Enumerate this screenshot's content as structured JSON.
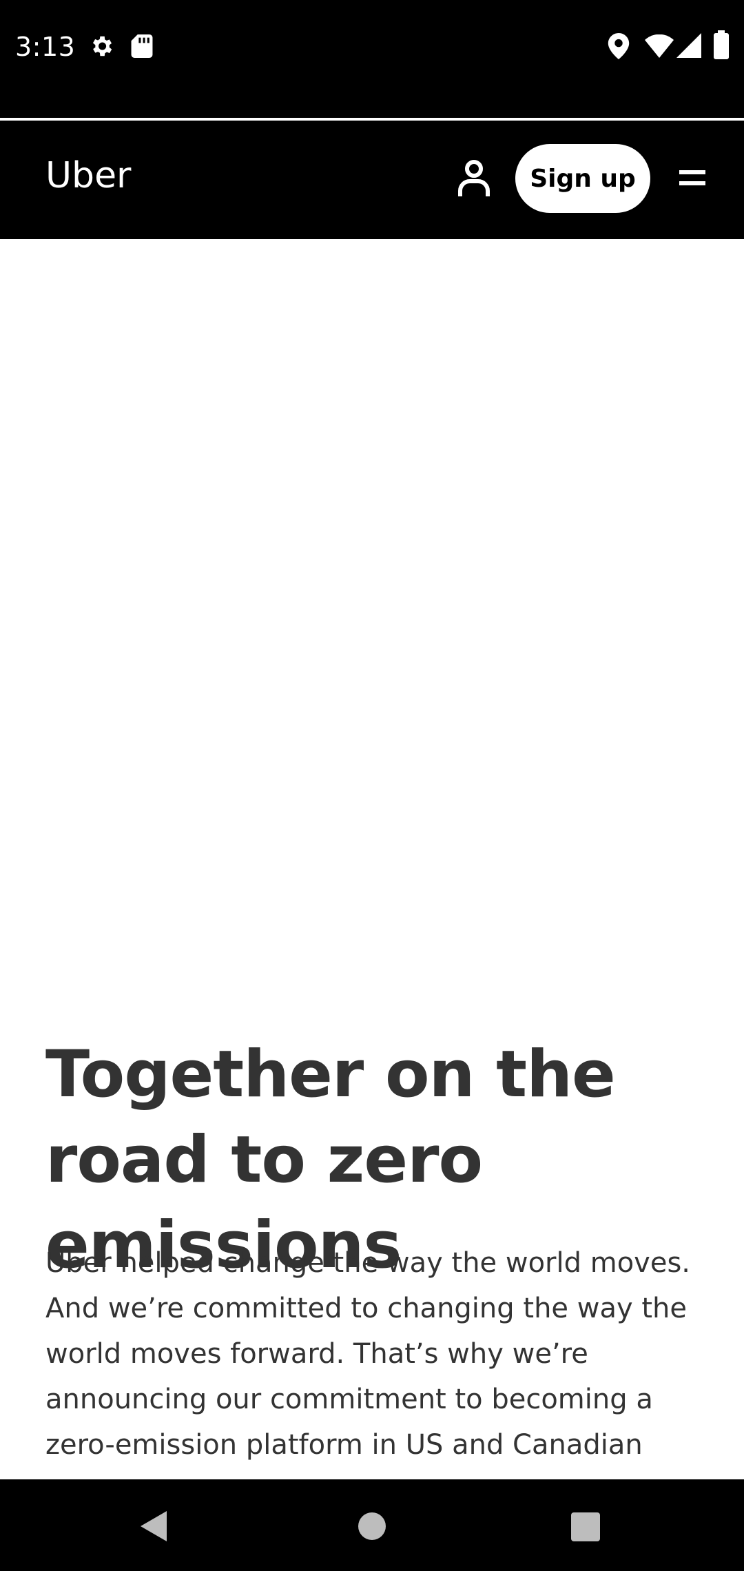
{
  "status_bar": {
    "time": "3:13",
    "icons": [
      "settings-icon",
      "sd-card-icon",
      "location-icon",
      "wifi-icon",
      "signal-icon",
      "battery-icon"
    ]
  },
  "navbar": {
    "logo": "Uber",
    "signup_label": "Sign up",
    "icons": [
      "user-icon",
      "menu-icon"
    ]
  },
  "content": {
    "headline": "Together on the road to zero emissions",
    "body": "Uber helped change the way the world moves. And we’re committed to changing the way the world moves forward. That’s why we’re announcing our commitment to becoming a zero-emission platform in US and Canadian"
  },
  "system_nav": {
    "icons": [
      "back-icon",
      "home-icon",
      "recents-icon"
    ]
  },
  "colors": {
    "header_bg": "#000000",
    "text_dark": "#333333",
    "button_bg": "#ffffff"
  }
}
